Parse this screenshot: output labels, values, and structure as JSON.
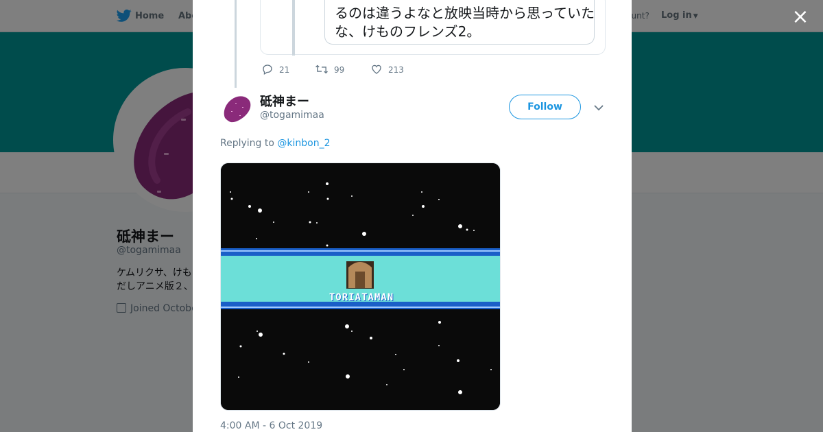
{
  "topnav": {
    "home_label": "Home",
    "about_label": "Abo",
    "account_text": "ccount?",
    "login_label": "Log in"
  },
  "profile": {
    "name": "砥神まー",
    "handle": "@togamimaa",
    "bio": "ケムリクサ、けもだしアニメ版２、",
    "joined": "Joined Octobe",
    "banner_color": "#009999"
  },
  "modal": {
    "close_label": "×",
    "quoted_text": "るのは違うよなと放映当時から思っていたな、けものフレンズ2。",
    "actions": {
      "replies": "21",
      "retweets": "99",
      "likes": "213"
    },
    "tweet": {
      "display_name": "砥神まー",
      "handle": "@togamimaa",
      "follow_label": "Follow",
      "replying_prefix": "Replying to ",
      "replying_to": "@kinbon_2",
      "media_caption": "TORIATAMAN",
      "timestamp": "4:00 AM - 6 Oct 2019"
    }
  },
  "colors": {
    "accent": "#1b95e0",
    "banner": "#009999",
    "media_band": "#6cdfd8",
    "media_band_border": "#1a5fc8"
  }
}
